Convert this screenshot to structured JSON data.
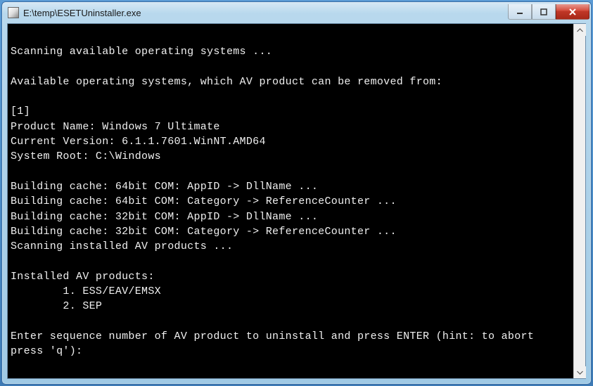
{
  "window": {
    "title": "E:\\temp\\ESETUninstaller.exe"
  },
  "console": {
    "lines": [
      "",
      "Scanning available operating systems ...",
      "",
      "Available operating systems, which AV product can be removed from:",
      "",
      "[1]",
      "Product Name: Windows 7 Ultimate",
      "Current Version: 6.1.1.7601.WinNT.AMD64",
      "System Root: C:\\Windows",
      "",
      "Building cache: 64bit COM: AppID -> DllName ...",
      "Building cache: 64bit COM: Category -> ReferenceCounter ...",
      "Building cache: 32bit COM: AppID -> DllName ...",
      "Building cache: 32bit COM: Category -> ReferenceCounter ...",
      "Scanning installed AV products ...",
      "",
      "Installed AV products:",
      "        1. ESS/EAV/EMSX",
      "        2. SEP",
      "",
      "Enter sequence number of AV product to uninstall and press ENTER (hint: to abort press 'q'):"
    ]
  }
}
